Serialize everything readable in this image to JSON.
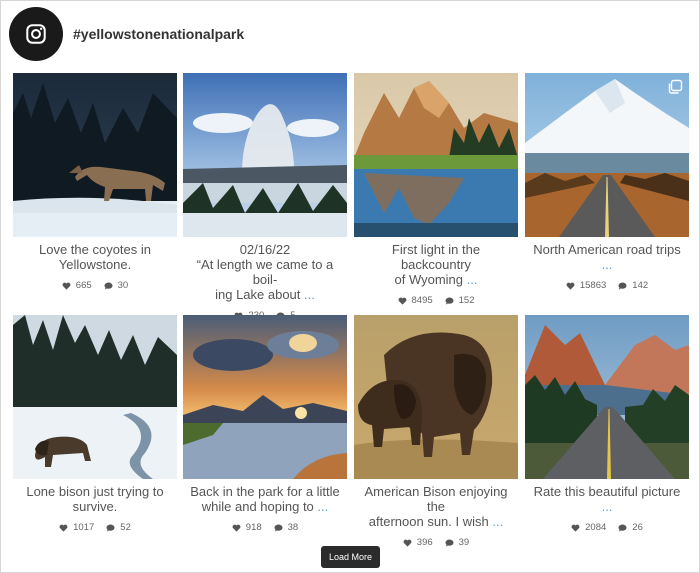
{
  "feed": {
    "handle": "#yellowstonenationalpark",
    "load_more_label": "Load More",
    "more_marker": "..."
  },
  "posts": [
    {
      "caption_lines": [
        "Love the coyotes in",
        "Yellowstone."
      ],
      "likes": "665",
      "comments": "30"
    },
    {
      "caption_lines": [
        "02/16/22",
        "“At length we came to a boil-",
        "ing Lake about"
      ],
      "likes": "230",
      "comments": "5"
    },
    {
      "caption_lines": [
        "First light in the backcountry",
        "of Wyoming"
      ],
      "likes": "8495",
      "comments": "152"
    },
    {
      "caption_lines": [
        "North American road trips"
      ],
      "likes": "15863",
      "comments": "142"
    },
    {
      "caption_lines": [
        "Lone bison just trying to",
        "survive."
      ],
      "likes": "1017",
      "comments": "52"
    },
    {
      "caption_lines": [
        "Back in the park for a little",
        "while and hoping to"
      ],
      "likes": "918",
      "comments": "38"
    },
    {
      "caption_lines": [
        "American Bison enjoying the",
        "afternoon sun. I wish"
      ],
      "likes": "396",
      "comments": "39"
    },
    {
      "caption_lines": [
        "Rate this beautiful picture"
      ],
      "likes": "2084",
      "comments": "26"
    }
  ]
}
